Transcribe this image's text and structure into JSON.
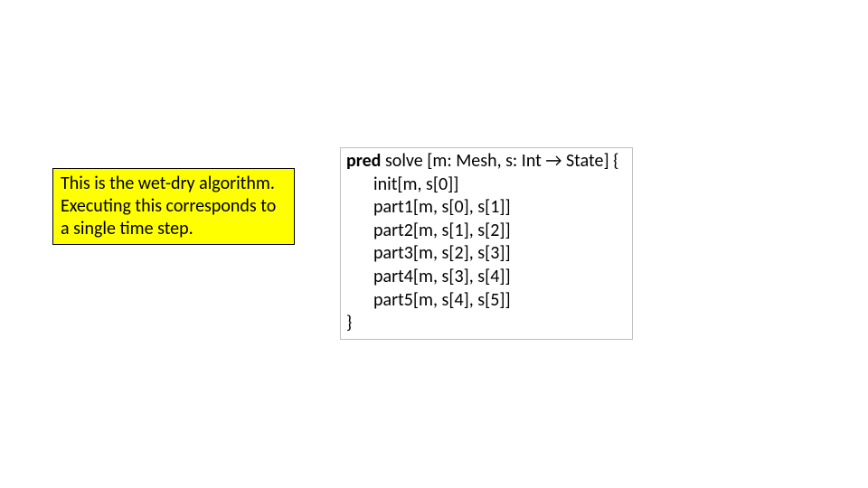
{
  "note": {
    "text": "This is the wet-dry algorithm. Executing this corresponds to a single time step."
  },
  "code": {
    "keyword": "pred",
    "sig_after_keyword": " solve [m: Mesh, s: Int → State] {",
    "body": [
      "init[m, s[0]]",
      "part1[m, s[0], s[1]]",
      "part2[m, s[1], s[2]]",
      "part3[m, s[2], s[3]]",
      "part4[m, s[3], s[4]]",
      "part5[m, s[4], s[5]]"
    ],
    "close": "}"
  }
}
